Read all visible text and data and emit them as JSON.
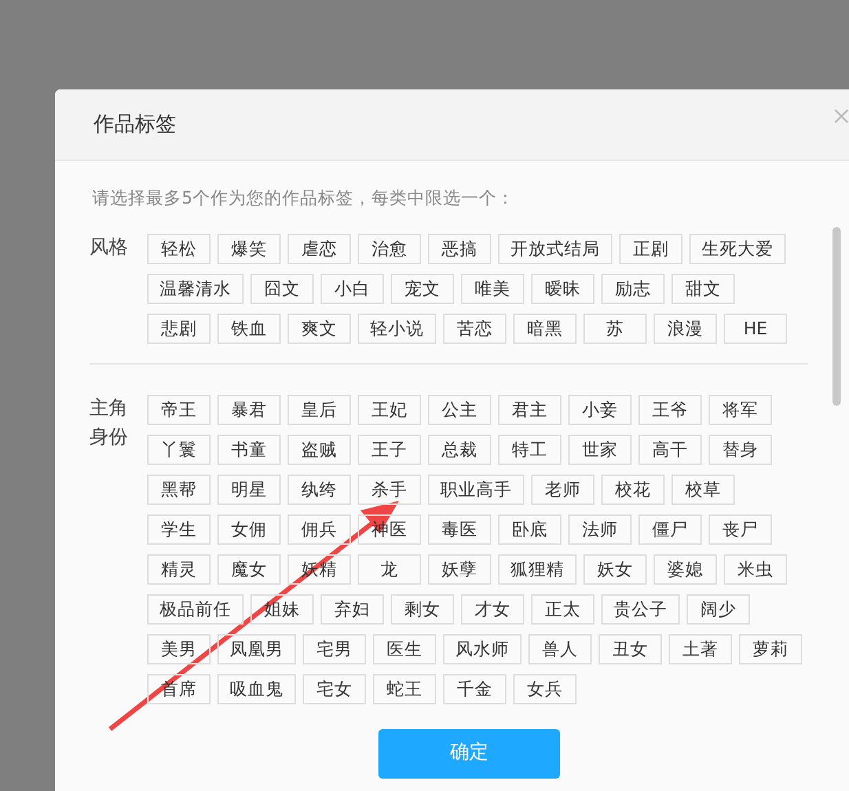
{
  "dialog": {
    "title": "作品标签",
    "instruction": "请选择最多5个作为您的作品标签，每类中限选一个：",
    "groups": [
      {
        "label": "风格",
        "tags": [
          "轻松",
          "爆笑",
          "虐恋",
          "治愈",
          "恶搞",
          "开放式结局",
          "正剧",
          "生死大爱",
          "温馨清水",
          "囧文",
          "小白",
          "宠文",
          "唯美",
          "暧昧",
          "励志",
          "甜文",
          "悲剧",
          "铁血",
          "爽文",
          "轻小说",
          "苦恋",
          "暗黑",
          "苏",
          "浪漫",
          "HE"
        ]
      },
      {
        "label": "主角身份",
        "tags": [
          "帝王",
          "暴君",
          "皇后",
          "王妃",
          "公主",
          "君主",
          "小妾",
          "王爷",
          "将军",
          "丫鬟",
          "书童",
          "盗贼",
          "王子",
          "总裁",
          "特工",
          "世家",
          "高干",
          "替身",
          "黑帮",
          "明星",
          "纨绔",
          "杀手",
          "职业高手",
          "老师",
          "校花",
          "校草",
          "学生",
          "女佣",
          "佣兵",
          "神医",
          "毒医",
          "卧底",
          "法师",
          "僵尸",
          "丧尸",
          "精灵",
          "魔女",
          "妖精",
          "龙",
          "妖孽",
          "狐狸精",
          "妖女",
          "婆媳",
          "米虫",
          "极品前任",
          "姐妹",
          "弃妇",
          "剩女",
          "才女",
          "正太",
          "贵公子",
          "阔少",
          "美男",
          "凤凰男",
          "宅男",
          "医生",
          "风水师",
          "兽人",
          "丑女",
          "土著",
          "萝莉",
          "首席",
          "吸血鬼",
          "宅女",
          "蛇王",
          "千金",
          "女兵"
        ]
      }
    ],
    "confirm_button": "确定"
  }
}
